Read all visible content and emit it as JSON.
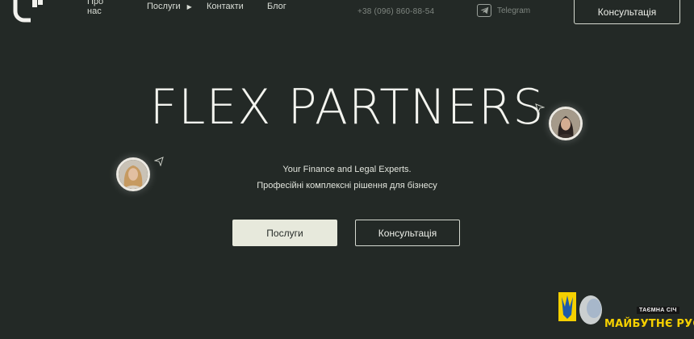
{
  "header": {
    "nav": [
      {
        "label": "Про нас"
      },
      {
        "label": "Послуги"
      },
      {
        "label": "Контакти"
      },
      {
        "label": "Блог"
      }
    ],
    "phone": "+38 (096) 860-88-54",
    "telegram_label": "Telegram",
    "cta_label": "Консультація"
  },
  "hero": {
    "title": "FLEX PARTNERS",
    "tagline": "Your Finance and Legal Experts.",
    "subtagline": "Професійні комплексні рішення для бізнесу",
    "primary_button": "Послуги",
    "secondary_button": "Консультація"
  },
  "watermark": {
    "box_text": "ТАЄМНА СІЧ",
    "text": "МАЙБУТНЄ РУСІ"
  },
  "colors": {
    "background": "#232926",
    "primary_button_bg": "#e7e9dc",
    "text": "#f3f4ef",
    "watermark_yellow": "#f5d000"
  },
  "icons": [
    "logo-icon",
    "chevron-right-icon",
    "telegram-icon",
    "cursor-pointer-icon"
  ]
}
